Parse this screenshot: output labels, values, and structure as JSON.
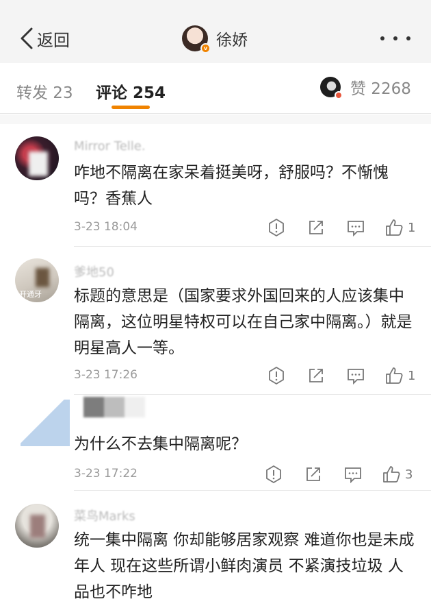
{
  "header": {
    "back_label": "返回",
    "title": "徐娇",
    "verified_badge": "v"
  },
  "tabs": {
    "repost": "转发 23",
    "comment": "评论 254",
    "likes": "赞 2268"
  },
  "comments": [
    {
      "user": "Mirror Telle.",
      "text": "咋地不隔离在家呆着挺美呀，舒服吗？不惭愧吗？香蕉人",
      "time": "3-23 18:04",
      "likes": "1"
    },
    {
      "user": "爹地50",
      "avatar_caption": "开通牙",
      "text": "标题的意思是（国家要求外国回来的人应该集中隔离，这位明星特权可以在自己家中隔离。）就是明星高人一等。",
      "time": "3-23 17:26",
      "likes": "1"
    },
    {
      "text": "为什么不去集中隔离呢？",
      "time": "3-23 17:22",
      "likes": "3"
    },
    {
      "user": "菜鸟Marks",
      "text": "统一集中隔离  你却能够居家观察   难道你也是未成年人  现在这些所谓小鲜肉演员 不紧演技垃圾  人品也不咋地"
    }
  ],
  "icons": {
    "back": "chevron-left-icon",
    "more": "more-dots-icon",
    "report": "report-icon",
    "share": "share-icon",
    "reply": "comment-icon",
    "like": "thumbs-up-icon"
  },
  "colors": {
    "accent": "#f08300",
    "header_bg": "#f4f4f4"
  }
}
